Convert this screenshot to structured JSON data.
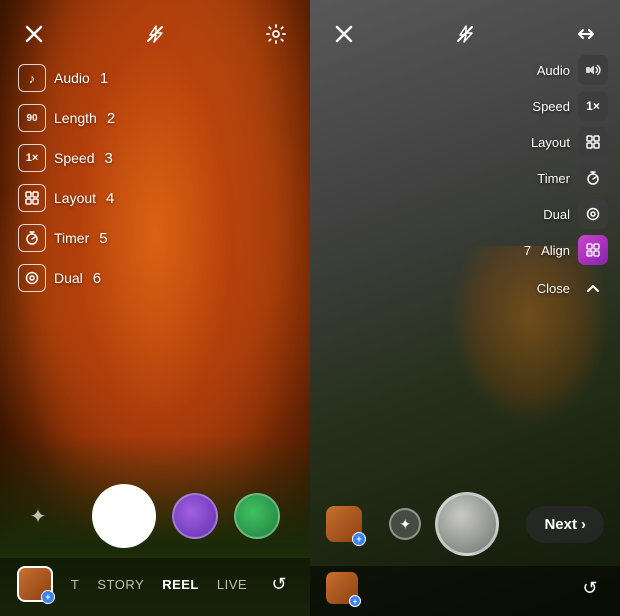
{
  "left": {
    "topbar": {
      "close_label": "×",
      "flash_label": "flash-off",
      "settings_label": "settings"
    },
    "menu": [
      {
        "icon": "♪",
        "label": "Audio",
        "number": "1"
      },
      {
        "icon": "90",
        "label": "Length",
        "number": "2"
      },
      {
        "icon": "1×",
        "label": "Speed",
        "number": "3"
      },
      {
        "icon": "⊞",
        "label": "Layout",
        "number": "4"
      },
      {
        "icon": "⏱",
        "label": "Timer",
        "number": "5"
      },
      {
        "icon": "◎",
        "label": "Dual",
        "number": "6"
      }
    ],
    "modes": [
      "T",
      "STORY",
      "REEL",
      "LIVE"
    ],
    "active_mode": "REEL",
    "sparkle": "✦",
    "next_label": "",
    "refresh_label": "↺"
  },
  "right": {
    "topbar": {
      "close_label": "×",
      "flash_label": "flash-off",
      "flip_label": "flip"
    },
    "menu": [
      {
        "label": "Audio",
        "icon": "audio-icon"
      },
      {
        "label": "Speed",
        "value": "1×"
      },
      {
        "label": "Layout",
        "icon": "layout-icon"
      },
      {
        "label": "Timer",
        "icon": "timer-icon"
      },
      {
        "label": "Dual",
        "icon": "dual-icon"
      },
      {
        "label": "Align",
        "icon": "align-icon",
        "number": "7",
        "highlight": true
      },
      {
        "label": "Close",
        "icon": "chevron-up-icon"
      }
    ],
    "next_button": "Next",
    "next_chevron": "›",
    "refresh_label": "↺"
  }
}
